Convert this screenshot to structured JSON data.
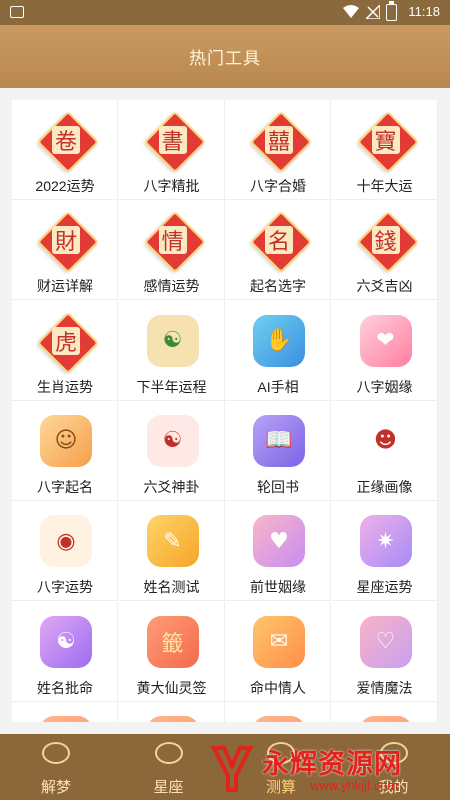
{
  "status_bar": {
    "time": "11:18",
    "battery": "3"
  },
  "header": {
    "title": "热门工具"
  },
  "colors": {
    "header": "#c99a61",
    "nav": "#8c673a",
    "accent_red": "#e23a34",
    "gold": "#ffd37a"
  },
  "tools": [
    {
      "label": "2022运势",
      "icon": "red-diamond-scroll-icon"
    },
    {
      "label": "八字精批",
      "icon": "red-diamond-book-icon"
    },
    {
      "label": "八字合婚",
      "icon": "red-diamond-double-happiness-icon"
    },
    {
      "label": "十年大运",
      "icon": "red-diamond-treasure-icon"
    },
    {
      "label": "财运详解",
      "icon": "red-diamond-gold-ingot-icon"
    },
    {
      "label": "感情运势",
      "icon": "red-diamond-love-letter-icon"
    },
    {
      "label": "起名选字",
      "icon": "red-diamond-scroll-brush-icon"
    },
    {
      "label": "六爻吉凶",
      "icon": "red-diamond-coin-icon"
    },
    {
      "label": "生肖运势",
      "icon": "red-diamond-tiger-icon"
    },
    {
      "label": "下半年运程",
      "icon": "yin-yang-landscape-icon"
    },
    {
      "label": "AI手相",
      "icon": "ai-palm-icon"
    },
    {
      "label": "八字姻缘",
      "icon": "pink-hearts-icon"
    },
    {
      "label": "八字起名",
      "icon": "baby-icon"
    },
    {
      "label": "六爻神卦",
      "icon": "bagua-icon"
    },
    {
      "label": "轮回书",
      "icon": "open-book-icon"
    },
    {
      "label": "正缘画像",
      "icon": "opera-portrait-icon"
    },
    {
      "label": "八字运势",
      "icon": "fortune-ball-icon"
    },
    {
      "label": "姓名测试",
      "icon": "name-card-icon"
    },
    {
      "label": "前世姻缘",
      "icon": "couple-silhouette-icon"
    },
    {
      "label": "星座运势",
      "icon": "zodiac-star-icon"
    },
    {
      "label": "姓名批命",
      "icon": "purple-bagua-icon"
    },
    {
      "label": "黄大仙灵签",
      "icon": "fortune-stick-icon"
    },
    {
      "label": "命中情人",
      "icon": "heart-envelope-icon"
    },
    {
      "label": "爱情魔法",
      "icon": "love-mirror-icon"
    },
    {
      "label": "",
      "icon": "partial-icon"
    },
    {
      "label": "",
      "icon": "partial-icon"
    },
    {
      "label": "",
      "icon": "partial-icon"
    },
    {
      "label": "",
      "icon": "partial-icon"
    }
  ],
  "nav": [
    {
      "label": "解梦",
      "icon": "speech-bubble-icon"
    },
    {
      "label": "星座",
      "icon": "speech-bubble-icon"
    },
    {
      "label": "测算",
      "icon": "compass-icon"
    },
    {
      "label": "我的",
      "icon": "user-icon"
    }
  ],
  "watermark": {
    "text": "永辉资源网",
    "url": "www.yhkjjl.com"
  }
}
